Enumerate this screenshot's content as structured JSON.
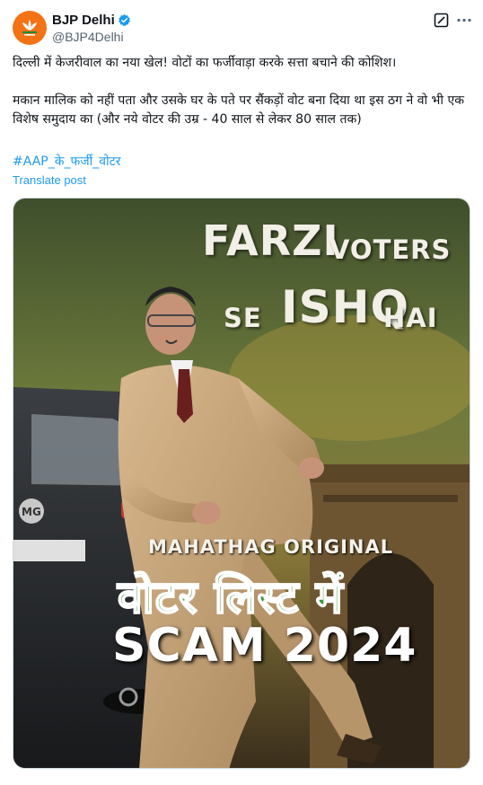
{
  "post": {
    "display_name": "BJP Delhi",
    "handle": "@BJP4Delhi",
    "verified": true,
    "text_line1": "दिल्ली में केजरीवाल का नया खेल! वोटों का फर्जीवाड़ा करके सत्ता बचाने की कोशिश।",
    "text_line2": "मकान मालिक को नहीं पता और उसके घर के पते पर सैंकड़ों वोट बना दिया था इस ठग ने वो भी एक विशेष समुदाय का (और नये वोटर की उम्र - 40 साल से लेकर 80 साल तक)",
    "hashtag": "#AAP_के_फर्जी_वोटर",
    "translate_label": "Translate post"
  },
  "poster": {
    "line1_big": "FARZI",
    "line1_small": "VOTERS",
    "line2_small_a": "SE",
    "line2_big": "ISHQ",
    "line2_small_b": "HAI",
    "subtitle": "MAHATHAG ORIGINAL",
    "hindi_title": "वोटर लिस्ट में",
    "scam_title": "SCAM 2024",
    "car_badge": "MG"
  },
  "icons": {
    "avatar": "bjp-lotus-logo",
    "verified": "verified-badge-icon",
    "grok": "grok-icon",
    "more": "more-dots-icon"
  },
  "colors": {
    "link": "#1d9bf0",
    "verified": "#1d9bf0",
    "avatar_bg": "#f47216",
    "hindi_title": "#3a9a3a"
  }
}
